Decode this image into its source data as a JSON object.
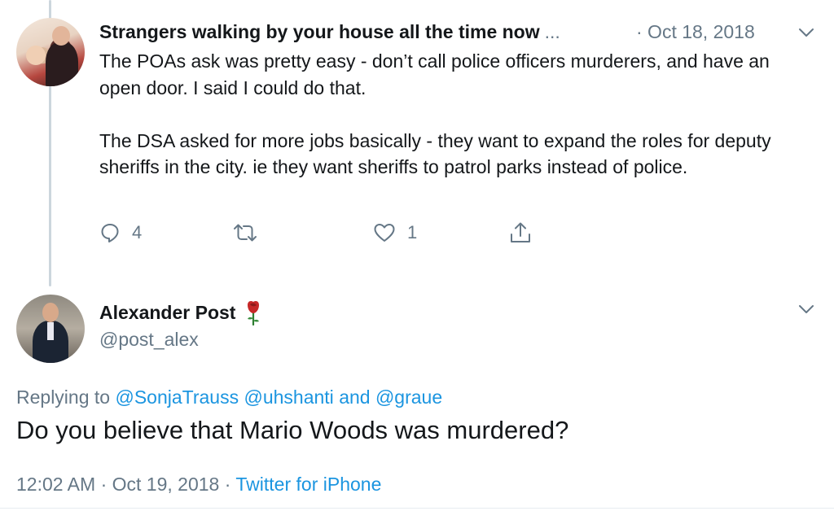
{
  "tweet1": {
    "display_name": "Strangers walking by your house all the time now",
    "ellipsis": "...",
    "date": "· Oct 18, 2018",
    "paragraphs": [
      "The POAs ask was pretty easy - don’t call police officers murderers, and have an open door. I said I could do that.",
      "The DSA asked for more jobs basically - they want to expand the roles for deputy sheriffs in the city. ie they want sheriffs to patrol parks instead of police."
    ],
    "actions": {
      "reply_count": "4",
      "retweet_count": "",
      "like_count": "1"
    },
    "icons": {
      "reply": "reply-icon",
      "retweet": "retweet-icon",
      "like": "heart-icon",
      "share": "share-icon",
      "menu": "chevron-down-icon"
    }
  },
  "tweet2": {
    "display_name": "Alexander Post",
    "handle": "@post_alex",
    "name_emoji": "rose-icon",
    "replying_prefix": "Replying to",
    "replying_mentions": [
      "@SonjaTrauss",
      "@uhshanti",
      "@graue"
    ],
    "replying_and": "and",
    "text": "Do you believe that Mario Woods was murdered?",
    "time": "12:02 AM",
    "date": "Oct 19, 2018",
    "separator": "·",
    "source": "Twitter for iPhone"
  },
  "colors": {
    "text": "#14171a",
    "secondary": "#657786",
    "link": "#1b95e0",
    "thread_line": "#ccd6dd"
  }
}
